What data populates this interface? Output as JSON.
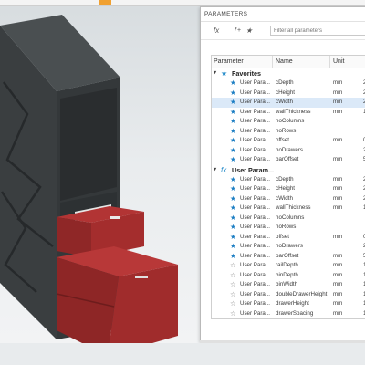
{
  "panel": {
    "title": "PARAMETERS",
    "fx_icon": "fx",
    "filter_placeholder": "Filter all parameters",
    "columns": {
      "parameter": "Parameter",
      "name": "Name",
      "unit": "Unit"
    }
  },
  "groups": {
    "favorites": {
      "label": "Favorites"
    },
    "user": {
      "label": "User Param..."
    }
  },
  "favorites_rows": [
    {
      "type": "User Para...",
      "name": "cDepth",
      "unit": "mm",
      "exp": "2",
      "fav": true
    },
    {
      "type": "User Para...",
      "name": "cHeight",
      "unit": "mm",
      "exp": "2",
      "fav": true
    },
    {
      "type": "User Para...",
      "name": "cWidth",
      "unit": "mm",
      "exp": "2",
      "fav": true,
      "selected": true
    },
    {
      "type": "User Para...",
      "name": "wallThickness",
      "unit": "mm",
      "exp": "1",
      "fav": true
    },
    {
      "type": "User Para...",
      "name": "noColumns",
      "unit": "",
      "exp": "",
      "fav": true
    },
    {
      "type": "User Para...",
      "name": "noRows",
      "unit": "",
      "exp": "",
      "fav": true
    },
    {
      "type": "User Para...",
      "name": "offset",
      "unit": "mm",
      "exp": "0",
      "fav": true
    },
    {
      "type": "User Para...",
      "name": "noDrawers",
      "unit": "",
      "exp": "2",
      "fav": true
    },
    {
      "type": "User Para...",
      "name": "barOffset",
      "unit": "mm",
      "exp": "5",
      "fav": true
    }
  ],
  "user_rows": [
    {
      "type": "User Para...",
      "name": "cDepth",
      "unit": "mm",
      "exp": "2",
      "fav": true
    },
    {
      "type": "User Para...",
      "name": "cHeight",
      "unit": "mm",
      "exp": "2",
      "fav": true
    },
    {
      "type": "User Para...",
      "name": "cWidth",
      "unit": "mm",
      "exp": "2",
      "fav": true
    },
    {
      "type": "User Para...",
      "name": "wallThickness",
      "unit": "mm",
      "exp": "1",
      "fav": true
    },
    {
      "type": "User Para...",
      "name": "noColumns",
      "unit": "",
      "exp": "",
      "fav": true
    },
    {
      "type": "User Para...",
      "name": "noRows",
      "unit": "",
      "exp": "",
      "fav": true
    },
    {
      "type": "User Para...",
      "name": "offset",
      "unit": "mm",
      "exp": "0",
      "fav": true
    },
    {
      "type": "User Para...",
      "name": "noDrawers",
      "unit": "",
      "exp": "2",
      "fav": true
    },
    {
      "type": "User Para...",
      "name": "barOffset",
      "unit": "mm",
      "exp": "5",
      "fav": true
    },
    {
      "type": "User Para...",
      "name": "railDepth",
      "unit": "mm",
      "exp": "1",
      "fav": false
    },
    {
      "type": "User Para...",
      "name": "binDepth",
      "unit": "mm",
      "exp": "1",
      "fav": false
    },
    {
      "type": "User Para...",
      "name": "binWidth",
      "unit": "mm",
      "exp": "1",
      "fav": false
    },
    {
      "type": "User Para...",
      "name": "doubleDrawerHeight",
      "unit": "mm",
      "exp": "1",
      "fav": false
    },
    {
      "type": "User Para...",
      "name": "drawerHeight",
      "unit": "mm",
      "exp": "1",
      "fav": false
    },
    {
      "type": "User Para...",
      "name": "drawerSpacing",
      "unit": "mm",
      "exp": "1",
      "fav": false
    },
    {
      "type": "User Para...",
      "name": "internalDrawerWidth",
      "unit": "mm",
      "exp": "1",
      "fav": false
    }
  ],
  "colors": {
    "cabinet": "#3d4143",
    "drawer": "#9e2b2b",
    "accent_blue": "#1e7fc4"
  }
}
